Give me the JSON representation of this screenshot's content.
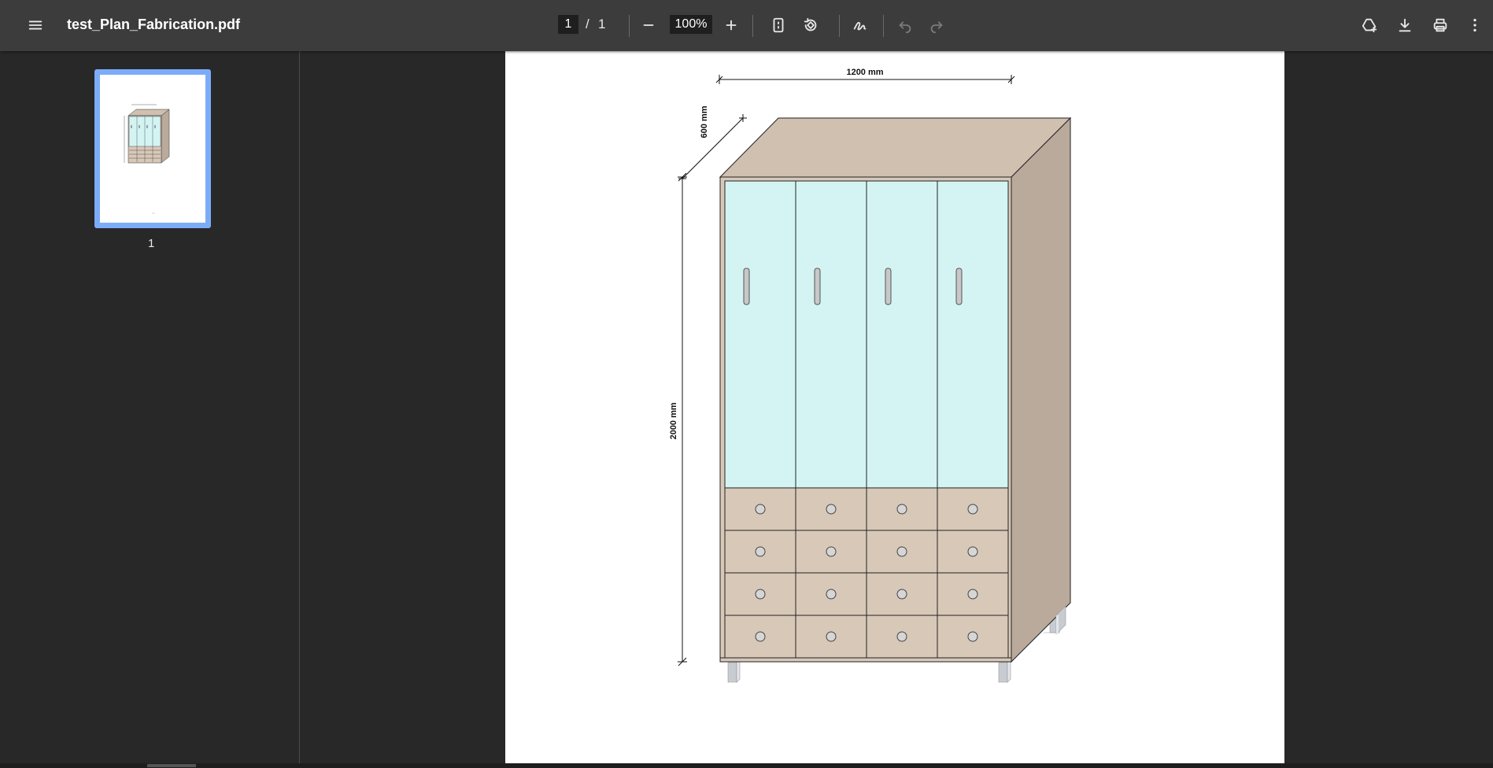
{
  "document": {
    "title": "test_Plan_Fabrication.pdf"
  },
  "pager": {
    "current": "1",
    "separator": "/",
    "total": "1"
  },
  "zoom": {
    "value": "100%"
  },
  "sidebar": {
    "thumbnails": [
      {
        "label": "1"
      }
    ]
  },
  "drawing": {
    "width_label": "1200 mm",
    "depth_label": "600 mm",
    "height_label": "2000 mm"
  },
  "colors": {
    "toolbar": "#3c3c3c",
    "background": "#282828",
    "thumb_selected": "#7cacf8",
    "glass": "#d4f4f4",
    "wood_front": "#d8c8b8",
    "wood_top": "#cfc0b0",
    "wood_side": "#baaa9c"
  },
  "icons": {
    "menu": "menu-icon",
    "zoom_out": "minus-icon",
    "zoom_in": "plus-icon",
    "fit": "fit-page-icon",
    "rotate": "rotate-icon",
    "annotate": "draw-icon",
    "undo": "undo-icon",
    "redo": "redo-icon",
    "drive": "drive-add-icon",
    "download": "download-icon",
    "print": "print-icon",
    "more": "more-vert-icon"
  }
}
